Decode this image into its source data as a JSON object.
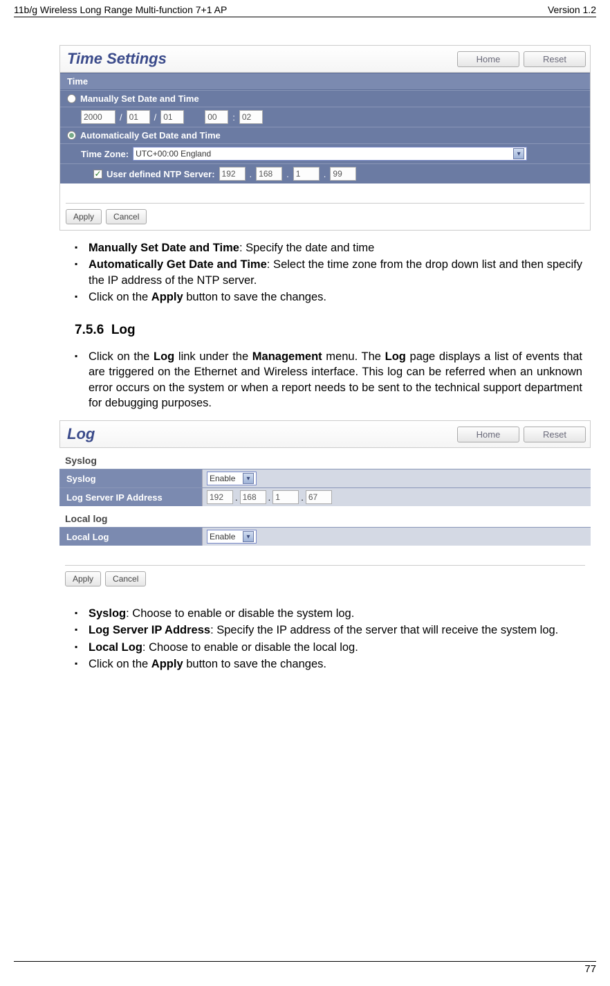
{
  "header": {
    "left": "11b/g Wireless Long Range Multi-function 7+1 AP",
    "right": "Version 1.2"
  },
  "panel1": {
    "title": "Time Settings",
    "home": "Home",
    "reset": "Reset",
    "section": "Time",
    "manual_label": "Manually Set Date and Time",
    "year": "2000",
    "mon": "01",
    "day": "01",
    "hh": "00",
    "mm": "02",
    "auto_label": "Automatically Get Date and Time",
    "tz_label": "Time Zone:",
    "tz_value": "UTC+00:00 England",
    "ntp_label": "User defined NTP Server:",
    "ip1": "192",
    "ip2": "168",
    "ip3": "1",
    "ip4": "99",
    "apply": "Apply",
    "cancel": "Cancel"
  },
  "list1": {
    "i1a": "Manually Set Date and Time",
    "i1b": ": Specify the date and time",
    "i2a": "Automatically Get Date and Time",
    "i2b": ": Select the time zone from the drop down list and then specify the IP address of the NTP server.",
    "i3a": "Click on the ",
    "i3b": "Apply",
    "i3c": " button to save the changes."
  },
  "sec756": {
    "num": "7.5.6",
    "title": "Log"
  },
  "list2": {
    "t1": "Click on the ",
    "t2": "Log",
    "t3": " link under the ",
    "t4": "Management",
    "t5": " menu. The ",
    "t6": "Log",
    "t7": " page displays a list of events that are triggered on the Ethernet and Wireless interface. This log can be referred when an unknown error occurs on the system or when a report needs to be sent to the technical support department for debugging purposes."
  },
  "panel2": {
    "title": "Log",
    "home": "Home",
    "reset": "Reset",
    "sec1": "Syslog",
    "r1": "Syslog",
    "r1v": "Enable",
    "r2": "Log Server IP Address",
    "ip1": "192",
    "ip2": "168",
    "ip3": "1",
    "ip4": "67",
    "sec2": "Local log",
    "r3": "Local Log",
    "r3v": "Enable",
    "apply": "Apply",
    "cancel": "Cancel"
  },
  "list3": {
    "a1": "Syslog",
    "a2": ": Choose to enable or disable the system log.",
    "b1": "Log Server IP Address",
    "b2": ": Specify the IP address of the server that will receive the system log.",
    "c1": "Local Log",
    "c2": ": Choose to enable or disable the local log.",
    "d1": "Click on the ",
    "d2": "Apply",
    "d3": " button to save the changes."
  },
  "pageno": "77"
}
